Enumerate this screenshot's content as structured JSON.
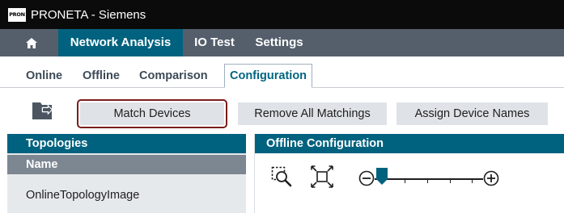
{
  "window": {
    "logo_text": "PRON",
    "title": "PRONETA - Siemens"
  },
  "menu": {
    "home_icon": "home-icon",
    "items": [
      {
        "label": "Network Analysis",
        "active": true
      },
      {
        "label": "IO Test",
        "active": false
      },
      {
        "label": "Settings",
        "active": false
      }
    ]
  },
  "subtabs": [
    {
      "label": "Online",
      "active": false
    },
    {
      "label": "Offline",
      "active": false
    },
    {
      "label": "Comparison",
      "active": false
    },
    {
      "label": "Configuration",
      "active": true
    }
  ],
  "toolbar": {
    "import_icon": "import-icon",
    "match_devices": "Match Devices",
    "remove_all_matchings": "Remove All Matchings",
    "assign_device_names": "Assign Device Names"
  },
  "topologies": {
    "header": "Topologies",
    "column_name": "Name",
    "rows": [
      "OnlineTopologyImage"
    ]
  },
  "offline_config": {
    "header": "Offline Configuration",
    "tools": [
      "zoom-area-icon",
      "fit-to-screen-icon",
      "zoom-out-icon",
      "zoom-in-icon"
    ],
    "zoom_level": 0.07
  },
  "colors": {
    "accent": "#00627e",
    "menubar": "#555f6b",
    "titlebar": "#0b0b0b",
    "button_bg": "#dfe3e7",
    "focus_ring": "#7a1d1d"
  }
}
